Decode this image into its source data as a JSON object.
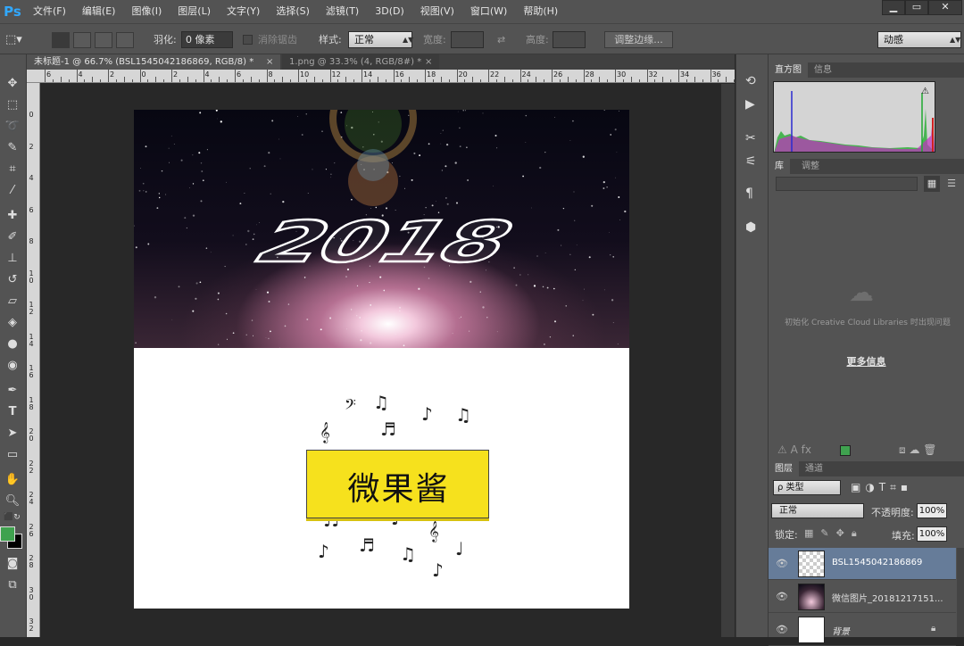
{
  "app": {
    "logo": "Ps"
  },
  "menu": [
    "文件(F)",
    "编辑(E)",
    "图像(I)",
    "图层(L)",
    "文字(Y)",
    "选择(S)",
    "滤镜(T)",
    "3D(D)",
    "视图(V)",
    "窗口(W)",
    "帮助(H)"
  ],
  "window_controls": {
    "minimize": "▁",
    "maximize": "▭",
    "close": "✕"
  },
  "options": {
    "feather_label": "羽化:",
    "feather_value": "0 像素",
    "antialias_label": "消除锯齿",
    "style_label": "样式:",
    "style_value": "正常",
    "width_label": "宽度:",
    "height_label": "高度:",
    "refine_edge": "调整边缘...",
    "workspace_value": "动感"
  },
  "doc_tabs": [
    {
      "label": "未标题-1 @ 66.7% (BSL1545042186869, RGB/8) *",
      "close": "×"
    },
    {
      "label": "1.png @ 33.3% (4, RGB/8#) *",
      "close": "×"
    }
  ],
  "ruler_h": [
    "6",
    "4",
    "2",
    "0",
    "2",
    "4",
    "6",
    "8",
    "10",
    "12",
    "14",
    "16",
    "18",
    "20",
    "22",
    "24",
    "26",
    "28",
    "30",
    "32",
    "34",
    "36"
  ],
  "ruler_v": [
    "0",
    "2",
    "4",
    "6",
    "8",
    "1 0",
    "1 2",
    "1 4",
    "1 6",
    "1 8",
    "2 0",
    "2 2",
    "2 4",
    "2 6",
    "2 8",
    "3 0",
    "3 2"
  ],
  "canvas": {
    "year_text": "2018",
    "sign_text": "微果酱"
  },
  "panels": {
    "histogram_tabs": [
      "直方图",
      "信息"
    ],
    "library_tabs": [
      "库",
      "调整"
    ],
    "cc_message": "初始化 Creative Cloud Libraries 时出现问题",
    "more_info": "更多信息",
    "layers_tabs": [
      "图层",
      "通道"
    ],
    "filter_kind": "ρ 类型",
    "blend_mode": "正常",
    "opacity_label": "不透明度:",
    "opacity_value": "100%",
    "lock_label": "锁定:",
    "fill_label": "填充:",
    "fill_value": "100%",
    "layers": [
      {
        "name": "BSL1545042186869",
        "selected": true
      },
      {
        "name": "微信图片_20181217151...",
        "selected": false
      },
      {
        "name": "背景",
        "selected": false
      }
    ]
  },
  "colors": {
    "foreground": "#3fa24f",
    "background": "#000000",
    "accent_selected": "#667c99",
    "sign_yellow": "#f6e11d"
  }
}
